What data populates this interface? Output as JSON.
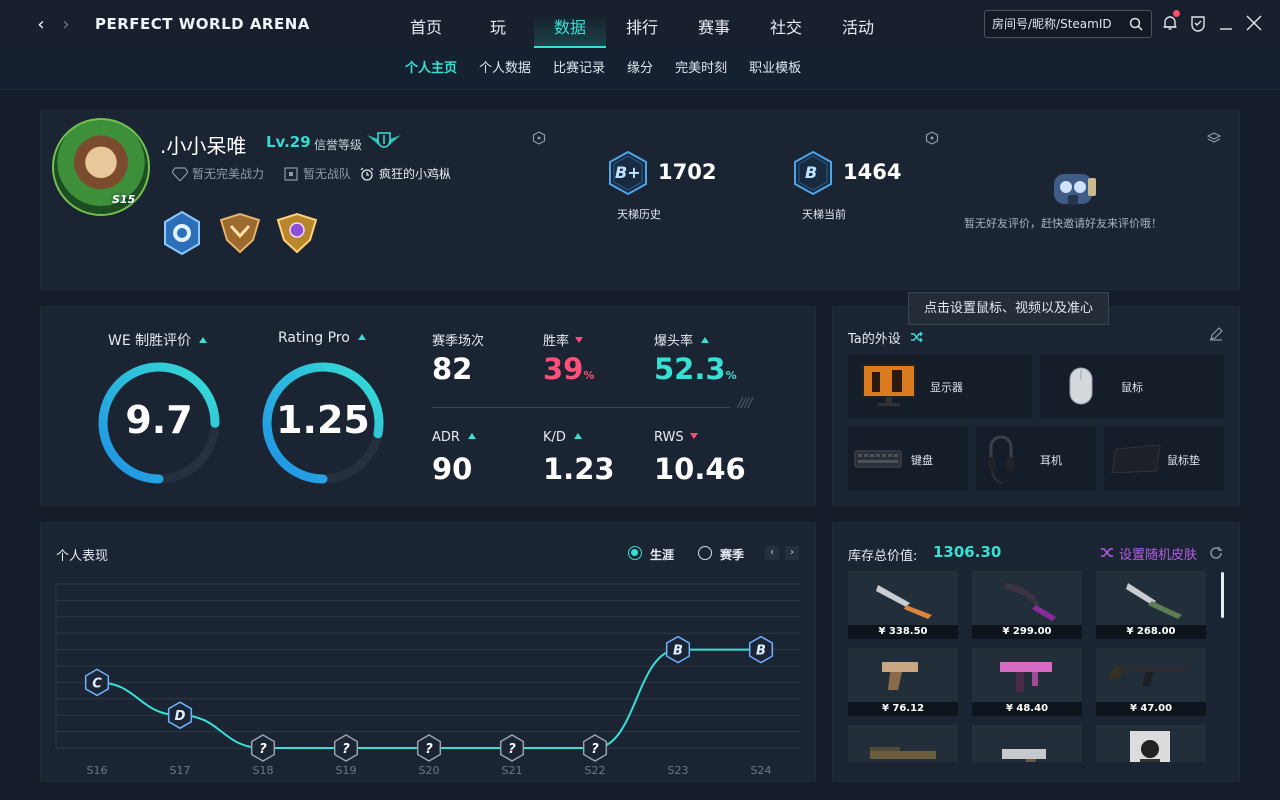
{
  "app": {
    "title": "PERFECT WORLD ARENA"
  },
  "nav": {
    "tabs": [
      "首页",
      "玩",
      "数据",
      "排行",
      "赛事",
      "社交",
      "活动"
    ],
    "active": "数据"
  },
  "search": {
    "placeholder": "房间号/昵称/SteamID"
  },
  "subnav": {
    "tabs": [
      "个人主页",
      "个人数据",
      "比赛记录",
      "缘分",
      "完美时刻",
      "职业模板"
    ],
    "active": "个人主页"
  },
  "profile": {
    "username": ".小小呆唯",
    "level": "Lv.29",
    "honor_label": "信誉等级",
    "season_tag": "S15",
    "tags": [
      "暂无完美战力",
      "暂无战队",
      "疯狂的小鸡枞"
    ]
  },
  "ladder": {
    "history": {
      "grade": "B+",
      "score": "1702",
      "label": "天梯历史"
    },
    "current": {
      "grade": "B",
      "score": "1464",
      "label": "天梯当前"
    }
  },
  "friend_review": {
    "text": "暂无好友评价，赶快邀请好友来评价哦！"
  },
  "tooltip": {
    "text": "点击设置鼠标、视频以及准心"
  },
  "stats": {
    "we": {
      "title": "WE 制胜评价",
      "value": "9.7",
      "fraction": 0.75
    },
    "rating": {
      "title": "Rating Pro",
      "value": "1.25",
      "fraction": 0.78
    },
    "matches": {
      "label": "赛季场次",
      "value": "82"
    },
    "winrate": {
      "label": "胜率",
      "value": "39",
      "unit": "%"
    },
    "headshot": {
      "label": "爆头率",
      "value": "52.3",
      "unit": "%"
    },
    "adr": {
      "label": "ADR",
      "value": "90"
    },
    "kd": {
      "label": "K/D",
      "value": "1.23"
    },
    "rws": {
      "label": "RWS",
      "value": "10.46"
    }
  },
  "gear": {
    "title": "Ta的外设",
    "items": {
      "monitor": "显示器",
      "mouse": "鼠标",
      "keyboard": "键盘",
      "headset": "耳机",
      "mousepad": "鼠标垫"
    }
  },
  "performance": {
    "title": "个人表现",
    "options": {
      "career": "生涯",
      "season": "赛季"
    },
    "selected": "生涯"
  },
  "chart_data": {
    "type": "line",
    "categories": [
      "S16",
      "S17",
      "S18",
      "S19",
      "S20",
      "S21",
      "S22",
      "S23",
      "S24"
    ],
    "grades": [
      "C",
      "D",
      "?",
      "?",
      "?",
      "?",
      "?",
      "B",
      "B"
    ],
    "values": [
      4,
      2,
      0,
      0,
      0,
      0,
      0,
      6,
      6
    ],
    "ylim": [
      0,
      10
    ],
    "grid": true,
    "line_color": "#38e0d4"
  },
  "inventory": {
    "title": "库存总价值:",
    "total": "1306.30",
    "random_skin": "设置随机皮肤",
    "items": [
      {
        "price": "¥ 338.50",
        "kind": "knife-orange"
      },
      {
        "price": "¥ 299.00",
        "kind": "knife-purple"
      },
      {
        "price": "¥ 268.00",
        "kind": "knife-camo"
      },
      {
        "price": "¥ 76.12",
        "kind": "pistol-tan"
      },
      {
        "price": "¥ 48.40",
        "kind": "smg-pink"
      },
      {
        "price": "¥ 47.00",
        "kind": "rifle-black"
      },
      {
        "price": "",
        "kind": "shotgun-camo"
      },
      {
        "price": "",
        "kind": "pistol-silver"
      },
      {
        "price": "",
        "kind": "sticker-portrait"
      }
    ]
  }
}
